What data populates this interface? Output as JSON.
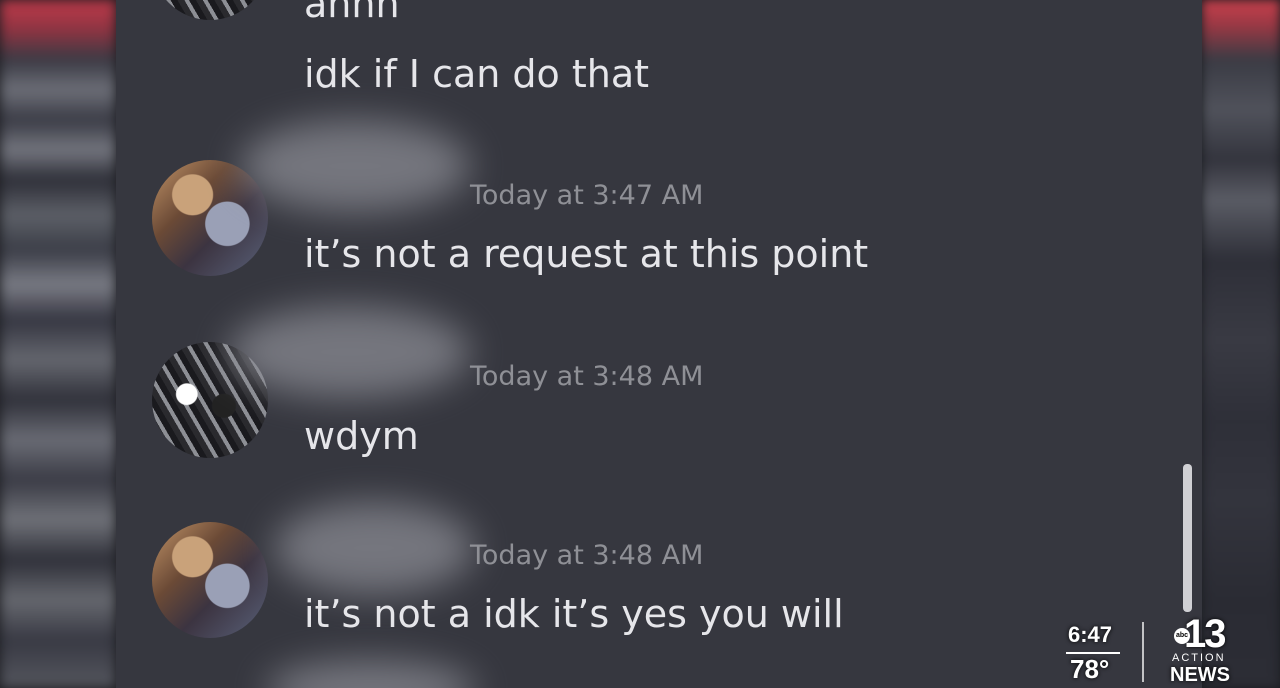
{
  "messages": [
    {
      "text": "ahhh"
    },
    {
      "text": "idk if I can do that"
    },
    {
      "timestamp": "Today at 3:47 AM",
      "text": "it’s not a request at this point"
    },
    {
      "timestamp": "Today at 3:48 AM",
      "text": "wdym"
    },
    {
      "timestamp": "Today at 3:48 AM",
      "text": "it’s not a idk it’s yes you will"
    }
  ],
  "news_bug": {
    "time": "6:47",
    "temperature": "78°",
    "station_number": "13",
    "network_badge": "abc",
    "action_label": "ACTION",
    "news_label": "NEWS"
  },
  "colors": {
    "chat_background": "#36373f",
    "message_text": "#e6e6ea",
    "timestamp_text": "#8f9096"
  }
}
